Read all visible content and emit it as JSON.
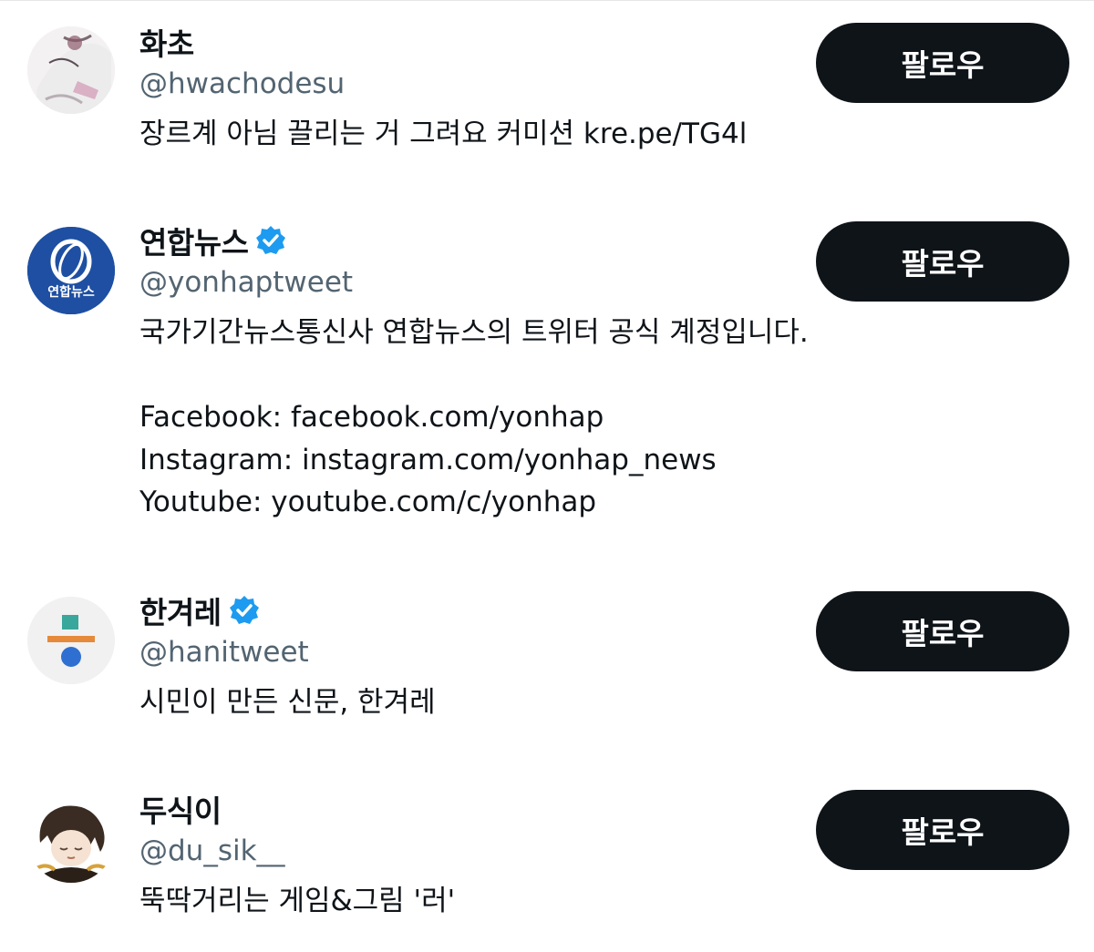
{
  "accounts": [
    {
      "name": "화초",
      "handle": "@hwachodesu",
      "verified": false,
      "bio": "장르계 아님 끌리는 거 그려요 커미션 kre.pe/TG4l",
      "follow_label": "팔로우",
      "avatar_icon": "sketch-avatar"
    },
    {
      "name": "연합뉴스",
      "handle": "@yonhaptweet",
      "verified": true,
      "bio": "국가기간뉴스통신사 연합뉴스의 트위터 공식 계정입니다.\n\nFacebook: facebook.com/yonhap\nInstagram: instagram.com/yonhap_news\nYoutube: youtube.com/c/yonhap",
      "follow_label": "팔로우",
      "avatar_text": "연합뉴스",
      "avatar_icon": "yonhap-logo"
    },
    {
      "name": "한겨레",
      "handle": "@hanitweet",
      "verified": true,
      "bio": "시민이 만든 신문, 한겨레",
      "follow_label": "팔로우",
      "avatar_icon": "hankyoreh-logo"
    },
    {
      "name": "두식이",
      "handle": "@du_sik__",
      "verified": false,
      "bio": "뚝딱거리는 게임&그림 '러'",
      "follow_label": "팔로우",
      "avatar_icon": "anime-character-avatar"
    }
  ],
  "colors": {
    "text": "#0f1419",
    "secondary_text": "#536471",
    "button_bg": "#0f1419",
    "verified_blue": "#1d9bf0",
    "yonhap_blue": "#1e4fa3",
    "hankyoreh_teal": "#3aa79c",
    "hankyoreh_orange": "#e58a3a",
    "hankyoreh_blue": "#2f6fd1"
  }
}
